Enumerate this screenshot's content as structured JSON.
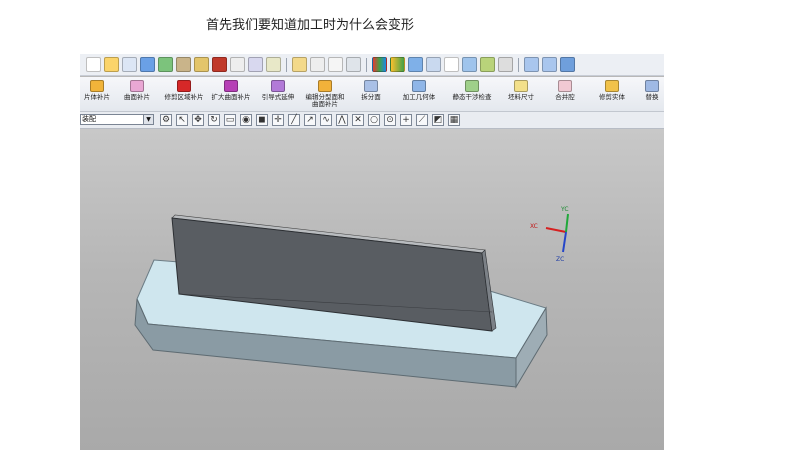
{
  "caption": "首先我们要知道加工时为什么会变形",
  "ribbon": {
    "items": [
      {
        "label": "片体补片"
      },
      {
        "label": "曲面补片"
      },
      {
        "label": "修剪区域补片"
      },
      {
        "label": "扩大曲面补片"
      },
      {
        "label": "引导式延伸"
      },
      {
        "label": "编辑分型面和\n曲面补片"
      },
      {
        "label": "拆分面"
      },
      {
        "label": "加工几何体"
      },
      {
        "label": "静态干涉检查"
      },
      {
        "label": "坯料尺寸"
      },
      {
        "label": "合并腔"
      },
      {
        "label": "修剪实体"
      },
      {
        "label": "替换"
      }
    ]
  },
  "selection_filter": {
    "value": "装配"
  },
  "triad": {
    "x_label": "XC",
    "y_label": "YC",
    "z_label": "ZC"
  },
  "colors": {
    "viewport_bg": "#b8b8b8",
    "base_top": "#cfe6ee",
    "base_side": "#8a9ba4",
    "plate_face": "#595d62",
    "axis_x": "#d62020",
    "axis_y": "#1fa83a",
    "axis_z": "#2546c9"
  }
}
